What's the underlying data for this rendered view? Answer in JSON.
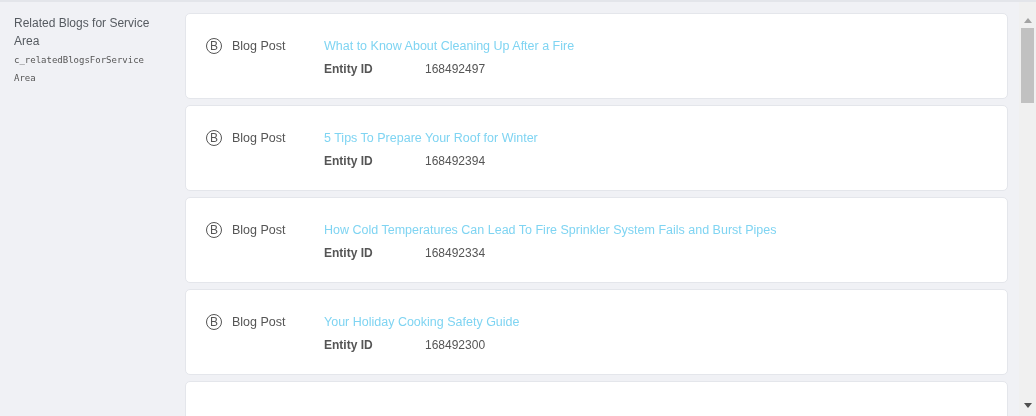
{
  "field": {
    "label": "Related Blogs for Service Area",
    "api_name": "c_relatedBlogsForService Area"
  },
  "entries": [
    {
      "type_badge": "B",
      "type": "Blog Post",
      "title": "What to Know About Cleaning Up After a Fire",
      "id_label": "Entity ID",
      "id": "168492497"
    },
    {
      "type_badge": "B",
      "type": "Blog Post",
      "title": "5 Tips To Prepare Your Roof for Winter",
      "id_label": "Entity ID",
      "id": "168492394"
    },
    {
      "type_badge": "B",
      "type": "Blog Post",
      "title": "How Cold Temperatures Can Lead To Fire Sprinkler System Fails and Burst Pipes",
      "id_label": "Entity ID",
      "id": "168492334"
    },
    {
      "type_badge": "B",
      "type": "Blog Post",
      "title": "Your Holiday Cooking Safety Guide",
      "id_label": "Entity ID",
      "id": "168492300"
    },
    {
      "kind": "partial"
    }
  ]
}
